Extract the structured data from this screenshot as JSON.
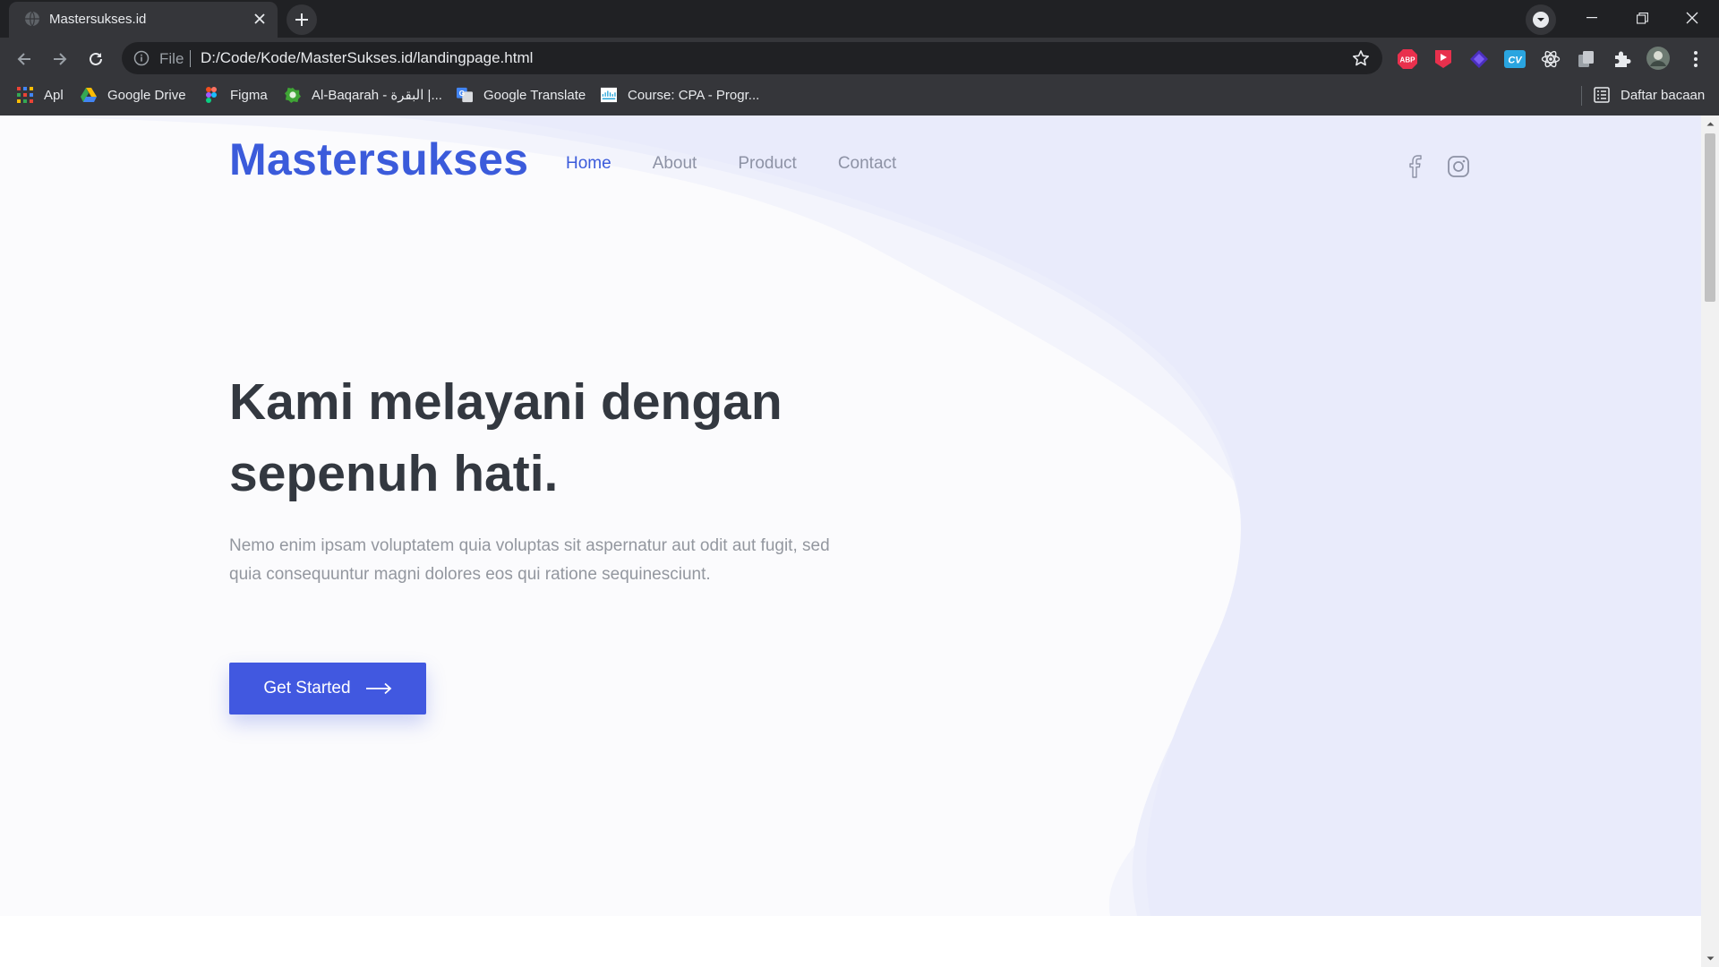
{
  "browser": {
    "tab": {
      "title": "Mastersukses.id",
      "favicon": "globe-icon"
    },
    "address": {
      "scheme": "File",
      "url": "D:/Code/Kode/MasterSukses.id/landingpage.html"
    },
    "extensions": [
      "adblock-plus-icon",
      "video-extension-icon",
      "diamond-extension-icon",
      "cv-extension-icon",
      "react-devtools-icon",
      "copy-extension-icon",
      "extensions-puzzle-icon",
      "profile-avatar-icon"
    ],
    "bookmarks": [
      {
        "label": "Apl",
        "icon": "apps-grid-icon"
      },
      {
        "label": "Google Drive",
        "icon": "google-drive-icon"
      },
      {
        "label": "Figma",
        "icon": "figma-icon"
      },
      {
        "label": "Al-Baqarah - البقرة |...",
        "icon": "quran-icon"
      },
      {
        "label": "Google Translate",
        "icon": "google-translate-icon"
      },
      {
        "label": "Course: CPA - Progr...",
        "icon": "cisco-icon"
      }
    ],
    "reading_list": "Daftar bacaan",
    "ext_badges": {
      "abp": "ABP",
      "cv": "CV"
    }
  },
  "page": {
    "brand": "Mastersukses",
    "nav": [
      {
        "label": "Home",
        "active": true
      },
      {
        "label": "About",
        "active": false
      },
      {
        "label": "Product",
        "active": false
      },
      {
        "label": "Contact",
        "active": false
      }
    ],
    "hero": {
      "headline": "Kami melayani dengan sepenuh hati.",
      "subtext": "Nemo enim ipsam voluptatem quia voluptas sit aspernatur aut odit aut fugit, sed quia consequuntur magni dolores eos qui ratione sequinesciunt.",
      "cta_label": "Get Started"
    }
  },
  "colors": {
    "accent": "#3b5bdb",
    "button": "#4158e0",
    "heading": "#333840",
    "body_text": "#93979f",
    "hero_wave": "#e9ebfb"
  }
}
